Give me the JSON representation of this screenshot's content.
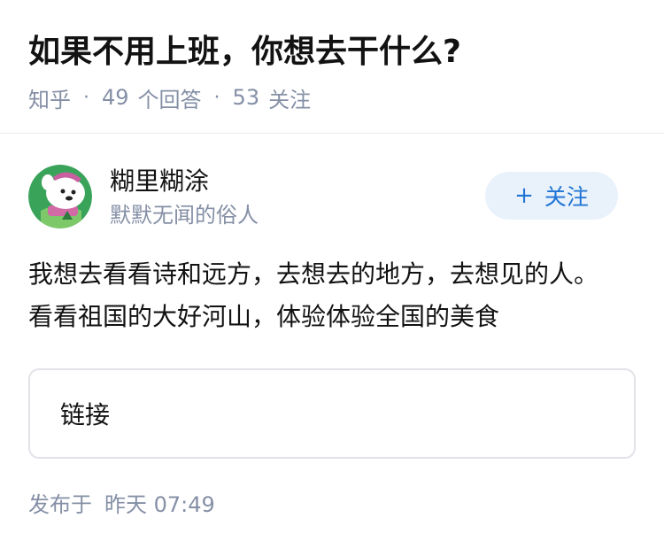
{
  "question": {
    "title": "如果不用上班，你想去干什么?",
    "source": "知乎",
    "separator": "·",
    "answer_count": "49",
    "answer_label": "个回答",
    "follower_count": "53",
    "follower_label": "关注"
  },
  "author": {
    "name": "糊里糊涂",
    "bio": "默默无闻的俗人",
    "avatar_icon": "cartoon-dog-avatar-icon",
    "follow_button": {
      "plus": "+",
      "label": "关注"
    }
  },
  "answer": {
    "text": "我想去看看诗和远方，去想去的地方，去想见的人。看看祖国的大好河山，体验体验全国的美食",
    "link_card_label": "链接",
    "published_label": "发布于",
    "published_time": "昨天 07:49"
  },
  "colors": {
    "accent": "#1f74d4",
    "follow_bg": "#e9f2fb",
    "meta_text": "#8590a6",
    "avatar_bg": "#3aa35a"
  }
}
